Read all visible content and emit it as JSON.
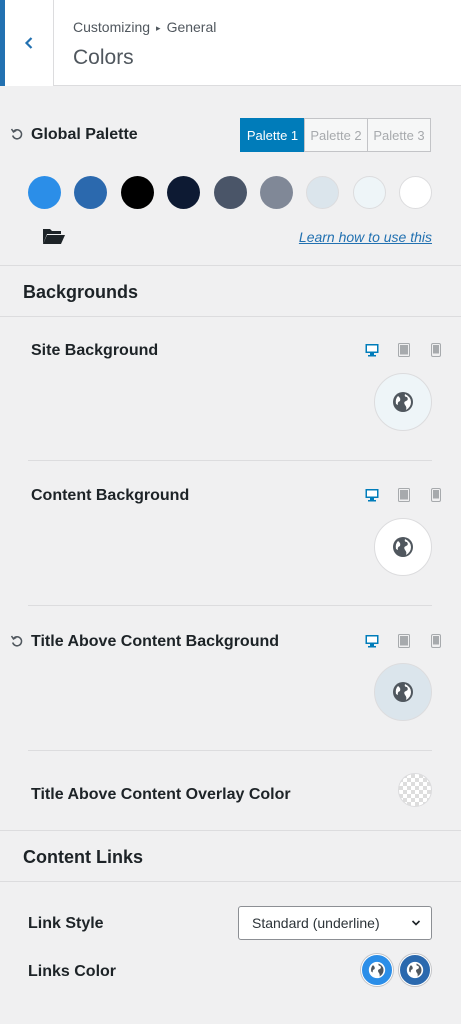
{
  "header": {
    "breadcrumb_parent": "Customizing",
    "breadcrumb_separator": "▸",
    "breadcrumb_child": "General",
    "title": "Colors"
  },
  "global_palette": {
    "label": "Global Palette",
    "tabs": [
      "Palette 1",
      "Palette 2",
      "Palette 3"
    ],
    "active_tab": "Palette 1",
    "swatches": [
      "#2b8ee8",
      "#2b69ae",
      "#000000",
      "#0d1a33",
      "#4a5568",
      "#808897",
      "#dbe5ec",
      "#eef5f8",
      "#ffffff"
    ],
    "learn_link": "Learn how to use this"
  },
  "sections": {
    "backgrounds": "Backgrounds",
    "content_links": "Content Links"
  },
  "settings": {
    "site_background": {
      "label": "Site Background",
      "color": "#eef5f8"
    },
    "content_background": {
      "label": "Content Background",
      "color": "#ffffff"
    },
    "title_above_content_background": {
      "label": "Title Above Content Background",
      "color": "#dbe5ec"
    },
    "title_above_content_overlay": {
      "label": "Title Above Content Overlay Color"
    },
    "link_style": {
      "label": "Link Style",
      "value": "Standard (underline)"
    },
    "links_color": {
      "label": "Links Color",
      "colors": [
        "#2b8ee8",
        "#2b69ae"
      ]
    }
  },
  "colors": {
    "accent": "#2271b1",
    "active_tab": "#007cba",
    "device_active": "#007cba",
    "device_inactive": "#a7aaad"
  }
}
